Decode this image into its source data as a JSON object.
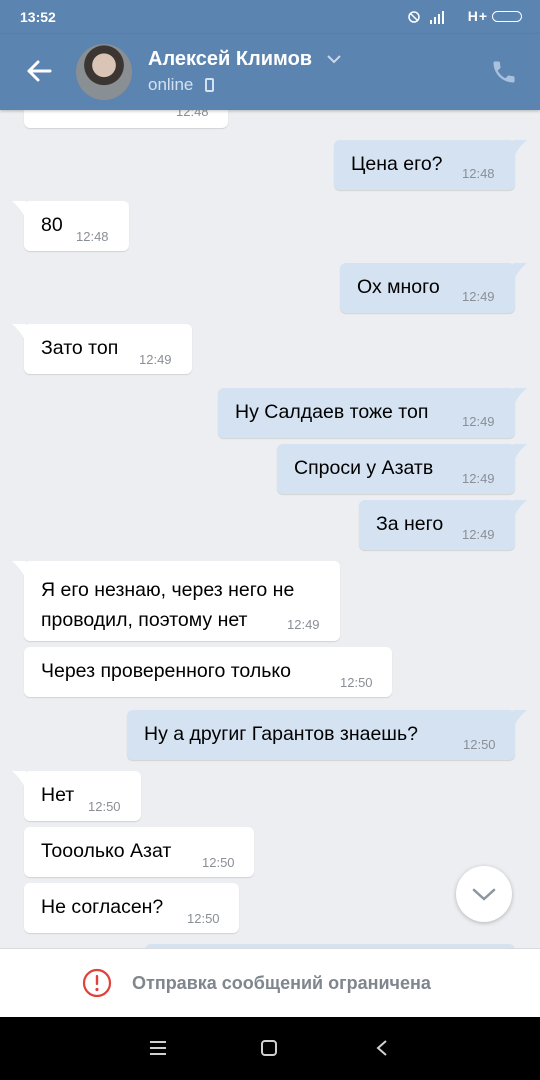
{
  "statusbar": {
    "time": "13:52",
    "network": "H+"
  },
  "header": {
    "contact_name": "Алексей Климов",
    "status": "online"
  },
  "messages": [
    {
      "dir": "in",
      "text": "",
      "time": "12:48"
    },
    {
      "dir": "out",
      "text": "Цена его?",
      "time": "12:48"
    },
    {
      "dir": "in",
      "text": "80",
      "time": "12:48"
    },
    {
      "dir": "out",
      "text": "Ох много",
      "time": "12:49"
    },
    {
      "dir": "in",
      "text": "Зато топ",
      "time": "12:49"
    },
    {
      "dir": "out",
      "text": "Ну Салдаев тоже топ",
      "time": "12:49"
    },
    {
      "dir": "out",
      "text": "Спроси у Азатв",
      "time": "12:49"
    },
    {
      "dir": "out",
      "text": "За него",
      "time": "12:49"
    },
    {
      "dir": "in",
      "text": "Я его незнаю, через него не\nпроводил, поэтому нет",
      "time": "12:49"
    },
    {
      "dir": "in",
      "text": "Через проверенного только",
      "time": "12:50"
    },
    {
      "dir": "out",
      "text": "Ну а другиг Гарантов знаешь?",
      "time": "12:50"
    },
    {
      "dir": "in",
      "text": "Нет",
      "time": "12:50"
    },
    {
      "dir": "in",
      "text": "Тоoолько Азат",
      "time": "12:50"
    },
    {
      "dir": "in",
      "text": "Не согласен?",
      "time": "12:50"
    }
  ],
  "restriction": {
    "text": "Отправка сообщений ограничена"
  },
  "colors": {
    "header": "#5b84b1",
    "bubble_out": "#d4e2f2",
    "bubble_in": "#ffffff",
    "background": "#eceef1"
  }
}
